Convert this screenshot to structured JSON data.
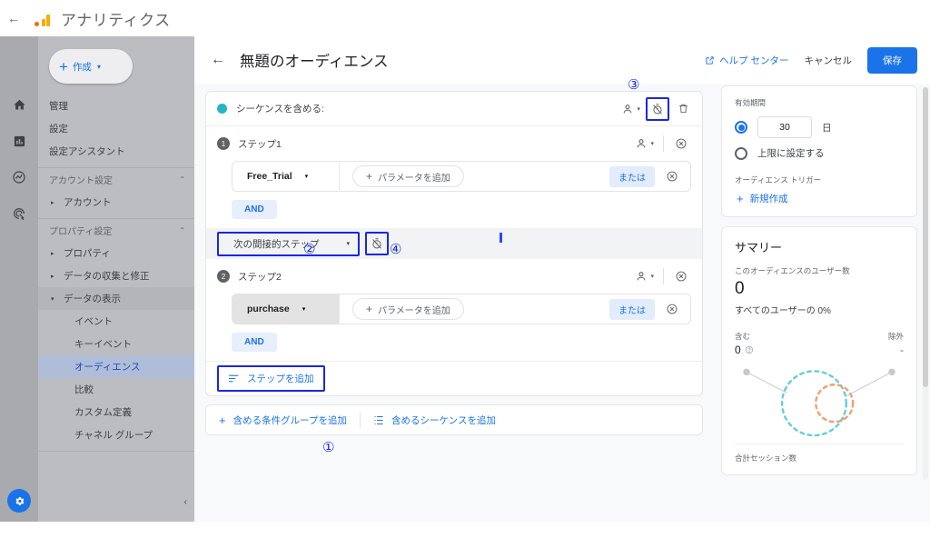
{
  "topbar": {
    "back_icon": "arrow-left-icon",
    "brand": "アナリティクス"
  },
  "rail": {
    "icons": [
      "home-icon",
      "reports-icon",
      "explore-icon",
      "advertising-icon"
    ],
    "settings_icon": "gear-icon"
  },
  "sidebar": {
    "create_button": {
      "label": "作成",
      "plus": "+",
      "caret": "▾"
    },
    "items": [
      {
        "label": "管理",
        "type": "item"
      },
      {
        "label": "設定",
        "type": "item"
      },
      {
        "label": "設定アシスタント",
        "type": "item"
      },
      {
        "label": "アカウント設定",
        "type": "section"
      },
      {
        "label": "アカウント",
        "type": "expandable",
        "marker": "▸"
      },
      {
        "label": "プロパティ設定",
        "type": "section"
      },
      {
        "label": "プロパティ",
        "type": "expandable",
        "marker": "▸"
      },
      {
        "label": "データの収集と修正",
        "type": "expandable",
        "marker": "▸"
      },
      {
        "label": "データの表示",
        "type": "expandable-open",
        "marker": "▾"
      },
      {
        "label": "イベント",
        "type": "sub"
      },
      {
        "label": "キーイベント",
        "type": "sub"
      },
      {
        "label": "オーディエンス",
        "type": "sub-selected"
      },
      {
        "label": "比較",
        "type": "sub"
      },
      {
        "label": "カスタム定義",
        "type": "sub"
      },
      {
        "label": "チャネル グループ",
        "type": "sub"
      }
    ]
  },
  "pagehead": {
    "back_icon": "arrow-left-icon",
    "title": "無題のオーディエンス",
    "help_label": "ヘルプ センター",
    "help_icon": "external-link-icon",
    "cancel_label": "キャンセル",
    "save_label": "保存"
  },
  "sequence": {
    "title": "シーケンスを含める:",
    "dot_color": "#26b5c6",
    "scope_icon": "person-icon",
    "scope_caret": "▾",
    "timer_icon": "timer-off-icon",
    "delete_icon": "trash-icon",
    "steps": [
      {
        "number": "1",
        "label": "ステップ1",
        "scope_icon": "person-icon",
        "scope_caret": "▾",
        "remove_icon": "remove-circle-icon",
        "condition": {
          "event": "Free_Trial",
          "caret": "▾",
          "add_param_label": "パラメータを追加",
          "add_param_plus": "+",
          "or_label": "または",
          "remove_icon": "remove-circle-icon",
          "hover": false
        },
        "and_label": "AND"
      },
      {
        "number": "2",
        "label": "ステップ2",
        "scope_icon": "person-icon",
        "scope_caret": "▾",
        "remove_icon": "remove-circle-icon",
        "condition": {
          "event": "purchase",
          "caret": "▾",
          "add_param_label": "パラメータを追加",
          "add_param_plus": "+",
          "or_label": "または",
          "remove_icon": "remove-circle-icon",
          "hover": true
        },
        "and_label": "AND"
      }
    ],
    "between": {
      "step_relation": "次の間接的ステップ",
      "caret": "▾",
      "timer_icon": "timer-off-icon"
    },
    "add_step": {
      "label": "ステップを追加",
      "icon": "add-step-icon"
    }
  },
  "bottom_bar": {
    "add_condition_group": {
      "label": "含める条件グループを追加",
      "icon": "plus-icon"
    },
    "add_sequence": {
      "label": "含めるシーケンスを追加",
      "icon": "list-icon"
    }
  },
  "right_panel": {
    "duration": {
      "label": "有効期間",
      "days_value": "30",
      "days_unit": "日",
      "max_option": "上限に設定する"
    },
    "trigger": {
      "label": "オーディエンス トリガー",
      "new_label": "新規作成",
      "plus": "+"
    },
    "summary": {
      "title": "サマリー",
      "users_label": "このオーディエンスのユーザー数",
      "users_value": "0",
      "percent_text": "すべてのユーザーの 0%",
      "include_label": "含む",
      "exclude_label": "除外",
      "include_value": "0",
      "include_help_icon": "help-circle-icon",
      "exclude_value": "-",
      "venn_outer_color": "#66ccdd",
      "venn_inner_color": "#f0a070",
      "sessions_label": "合計セッション数"
    }
  },
  "annotations": [
    {
      "id": "1",
      "glyph": "①"
    },
    {
      "id": "2",
      "glyph": "②"
    },
    {
      "id": "3",
      "glyph": "③"
    },
    {
      "id": "4",
      "glyph": "④"
    }
  ],
  "colors": {
    "accent": "#1a73e8",
    "annotation": "#1a27e0",
    "teal": "#26b5c6"
  }
}
